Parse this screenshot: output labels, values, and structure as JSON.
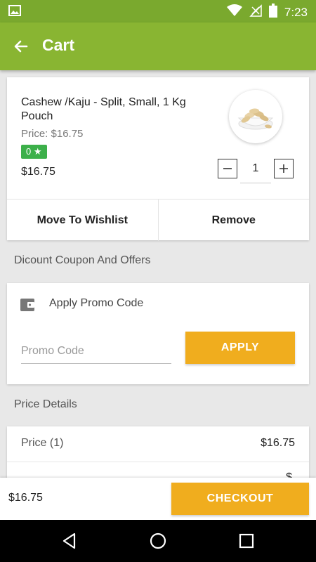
{
  "status_bar": {
    "time": "7:23",
    "icons": [
      "image-icon",
      "wifi-icon",
      "signal-icon",
      "battery-icon"
    ]
  },
  "app_bar": {
    "title": "Cart",
    "back_icon": "arrow-left-icon"
  },
  "cart_item": {
    "name": "Cashew /Kaju - Split, Small, 1 Kg Pouch",
    "price_label": "Price: $16.75",
    "rating": "0 ★",
    "total": "$16.75",
    "quantity": "1",
    "move_to_wishlist": "Move To Wishlist",
    "remove": "Remove"
  },
  "offers_section": {
    "heading": "Dicount Coupon And Offers"
  },
  "promo": {
    "title": "Apply Promo Code",
    "input_placeholder": "Promo Code",
    "input_value": "",
    "apply_label": "APPLY"
  },
  "price_details": {
    "heading": "Price Details",
    "rows": [
      {
        "label": "Price (1)",
        "value": "$16.75"
      }
    ],
    "next_row_value": "$"
  },
  "bottom_bar": {
    "total": "$16.75",
    "checkout_label": "CHECKOUT"
  },
  "colors": {
    "primary_green": "#89b532",
    "status_green": "#7aa92e",
    "accent_orange": "#f0ad1e",
    "rating_green": "#3cb04a"
  }
}
